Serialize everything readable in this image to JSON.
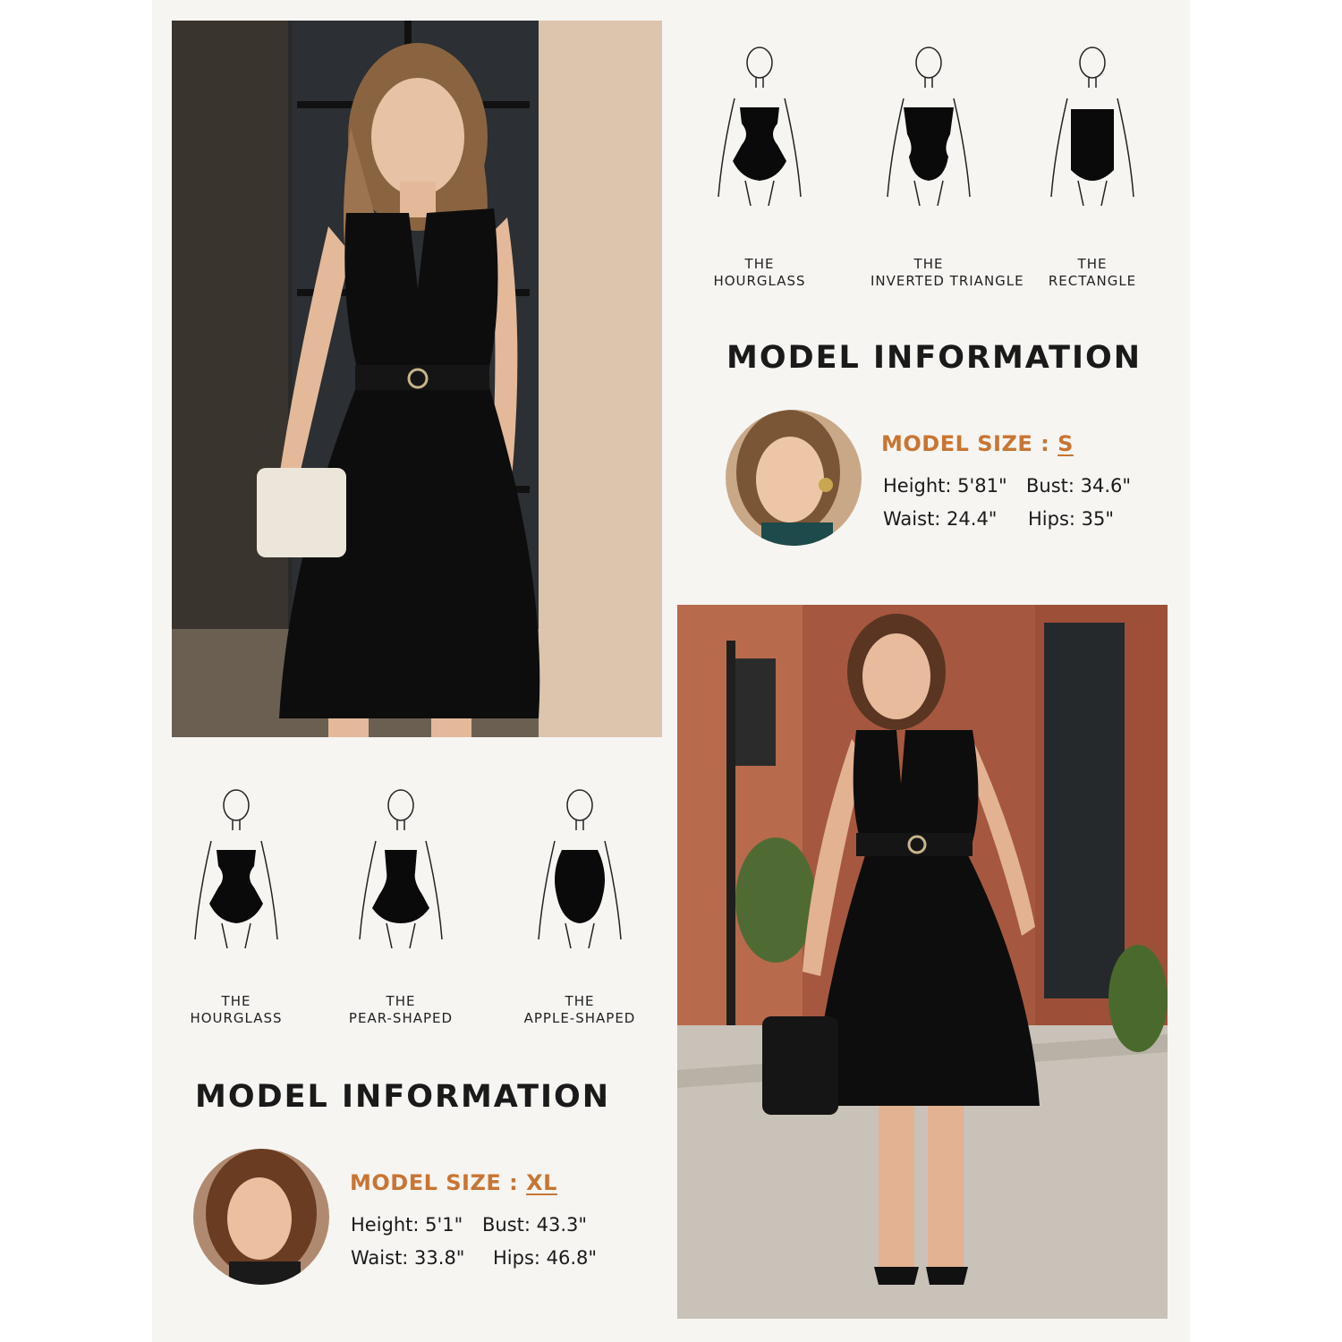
{
  "colors": {
    "accent": "#c87533",
    "panel": "#f6f5f2",
    "text": "#1a1a1a"
  },
  "top_section": {
    "shapes": [
      {
        "line1": "THE",
        "line2": "HOURGLASS",
        "icon": "hourglass-body-icon"
      },
      {
        "line1": "THE",
        "line2": "INVERTED TRIANGLE",
        "icon": "inverted-triangle-body-icon"
      },
      {
        "line1": "THE",
        "line2": "RECTANGLE",
        "icon": "rectangle-body-icon"
      }
    ],
    "title": "MODEL INFORMATION",
    "model_size_label": "MODEL SIZE :",
    "model_size": "S",
    "height": "Height: 5'81\"",
    "bust": "Bust: 34.6\"",
    "waist": "Waist: 24.4\"",
    "hips": "Hips: 35\""
  },
  "bottom_section": {
    "shapes": [
      {
        "line1": "THE",
        "line2": "HOURGLASS",
        "icon": "hourglass-body-icon"
      },
      {
        "line1": "THE",
        "line2": "PEAR-SHAPED",
        "icon": "pear-body-icon"
      },
      {
        "line1": "THE",
        "line2": "APPLE-SHAPED",
        "icon": "apple-body-icon"
      }
    ],
    "title": "MODEL INFORMATION",
    "model_size_label": "MODEL SIZE :",
    "model_size": "XL",
    "height": "Height: 5'1\"",
    "bust": "Bust: 43.3\"",
    "waist": "Waist: 33.8\"",
    "hips": "Hips: 46.8\""
  }
}
